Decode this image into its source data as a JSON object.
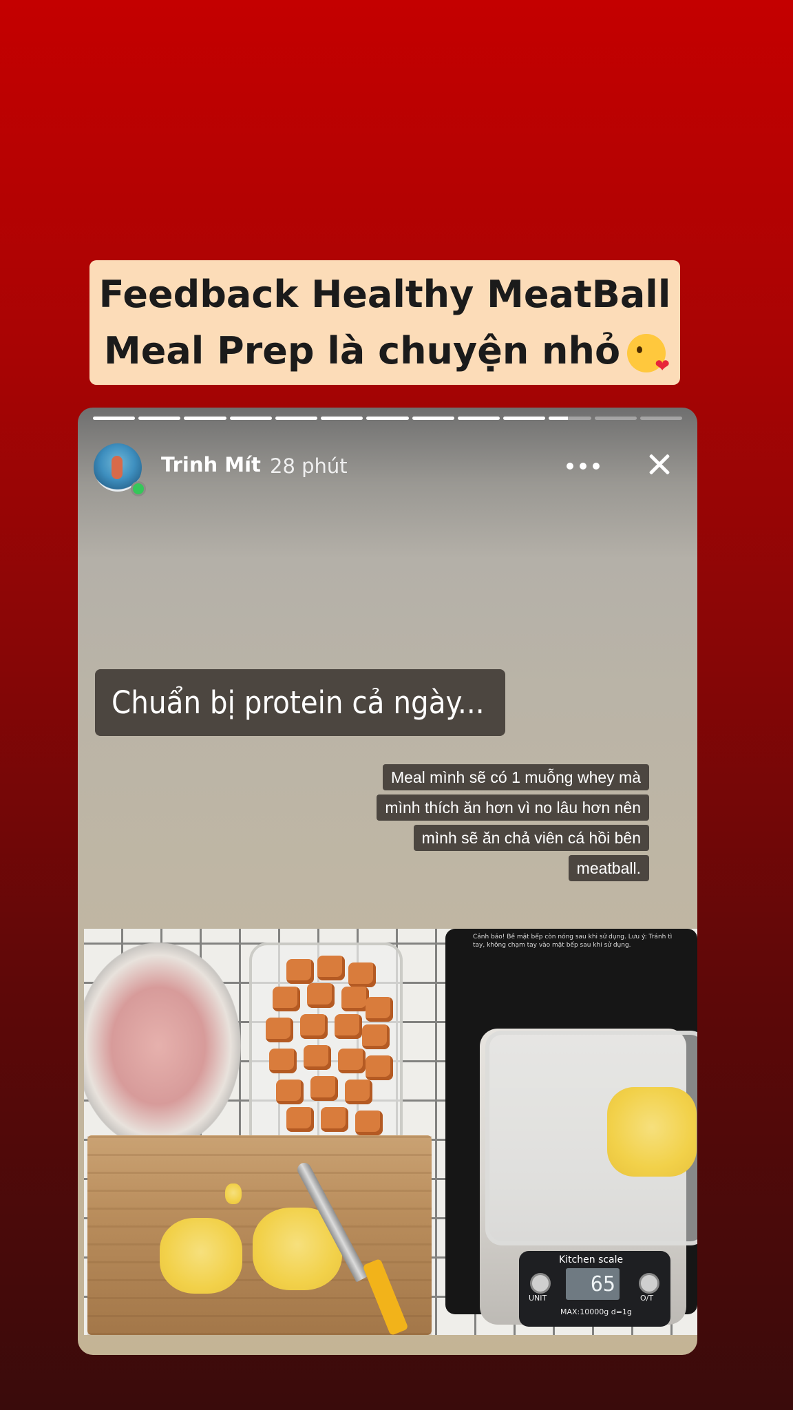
{
  "headline": {
    "line1": "Feedback Healthy MeatBall",
    "line2": "Meal Prep là chuyện nhỏ",
    "emoji": "face-blowing-kiss-emoji"
  },
  "story": {
    "progress_total": 13,
    "progress_completed": 10,
    "progress_current_fraction": 0.45,
    "username": "Trinh Mít",
    "time_ago": "28 phút",
    "online_color": "#34c759",
    "caption_main": "Chuẩn bị protein cả ngày...",
    "caption_lines": [
      "Meal mình sẽ có 1 muỗng whey mà",
      "mình thích ăn hơn vì no lâu hơn nên",
      "mình sẽ ăn chả viên cá hồi bên",
      "meatball."
    ],
    "photo": {
      "scale_title": "Kitchen scale",
      "scale_reading": "65",
      "scale_unit_button": "UNIT",
      "scale_tare_button": "O/T",
      "scale_capacity": "MAX:10000g  d=1g",
      "cooktop_warning": "Cảnh báo! Bề mặt bếp còn nóng sau khi sử dụng. Lưu ý: Tránh tì tay, không chạm tay vào mặt bếp sau khi sử dụng."
    }
  },
  "colors": {
    "background_top": "#c40000",
    "background_bottom": "#3a0b0b",
    "headline_bg": "#fcdcb8",
    "caption_bg": "#4c4640"
  }
}
